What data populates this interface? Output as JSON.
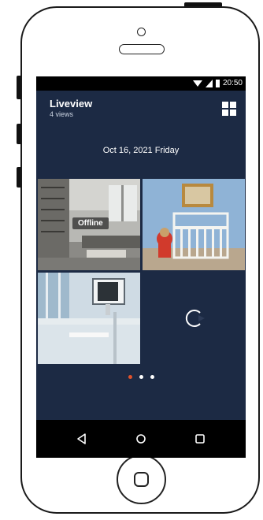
{
  "status_bar": {
    "time": "20:50",
    "icons": [
      "wifi-icon",
      "cell-signal-icon",
      "battery-icon"
    ]
  },
  "header": {
    "title": "Liveview",
    "subtitle": "4 views",
    "grid_icon": "grid-view-icon"
  },
  "date": {
    "text": "Oct 16, 2021  Friday"
  },
  "tiles": [
    {
      "name": "camera-living-room",
      "status": "Offline"
    },
    {
      "name": "camera-nursery",
      "status": ""
    },
    {
      "name": "camera-office",
      "status": ""
    },
    {
      "name": "camera-loading",
      "status": "",
      "icon": "loading-spinner-icon"
    }
  ],
  "pager": {
    "count": 3,
    "active_index": 0
  },
  "nav": {
    "icons": [
      "back-icon",
      "home-icon",
      "recent-apps-icon"
    ]
  },
  "colors": {
    "screen_bg": "#1c2a44",
    "accent": "#e0522b",
    "bars": "#000000"
  }
}
